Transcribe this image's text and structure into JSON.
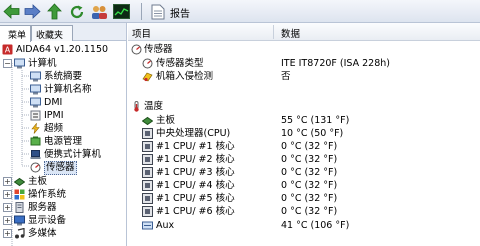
{
  "toolbar": {
    "report_label": "报告",
    "icons": [
      "back-arrow-icon",
      "forward-arrow-icon",
      "up-arrow-icon",
      "refresh-icon",
      "users-icon",
      "chart-icon",
      "report-icon"
    ]
  },
  "left_panel": {
    "tabs": [
      "菜单",
      "收藏夹"
    ],
    "tree": [
      {
        "label": "AIDA64 v1.20.1150",
        "icon": "aida64-icon"
      },
      {
        "label": "计算机",
        "icon": "computer-icon"
      },
      {
        "label": "系统摘要",
        "icon": "summary-icon"
      },
      {
        "label": "计算机名称",
        "icon": "computer-name-icon"
      },
      {
        "label": "DMI",
        "icon": "dmi-icon"
      },
      {
        "label": "IPMI",
        "icon": "ipmi-icon"
      },
      {
        "label": "超频",
        "icon": "overclock-icon"
      },
      {
        "label": "电源管理",
        "icon": "power-icon"
      },
      {
        "label": "便携式计算机",
        "icon": "laptop-icon"
      },
      {
        "label": "传感器",
        "icon": "sensor-icon",
        "selected": true
      },
      {
        "label": "主板",
        "icon": "motherboard-icon"
      },
      {
        "label": "操作系统",
        "icon": "os-icon"
      },
      {
        "label": "服务器",
        "icon": "server-icon"
      },
      {
        "label": "显示设备",
        "icon": "display-icon"
      },
      {
        "label": "多媒体",
        "icon": "multimedia-icon"
      }
    ]
  },
  "right_panel": {
    "columns": {
      "item": "项目",
      "data": "数据"
    },
    "groups": [
      {
        "title": "传感器",
        "icon": "sensor-group-icon",
        "rows": [
          {
            "item": "传感器类型",
            "value": "ITE IT8720F  (ISA 228h)",
            "icon": "sensor-icon"
          },
          {
            "item": "机箱入侵检测",
            "value": "否",
            "icon": "chassis-icon"
          }
        ]
      },
      {
        "title": "温度",
        "icon": "thermometer-icon",
        "rows": [
          {
            "item": "主板",
            "value": "55 °C  (131 °F)",
            "icon": "motherboard-icon"
          },
          {
            "item": "中央处理器(CPU)",
            "value": "10 °C  (50 °F)",
            "icon": "cpu-icon"
          },
          {
            "item": "#1 CPU/ #1 核心",
            "value": "0 °C  (32 °F)",
            "icon": "cpu-core-icon"
          },
          {
            "item": "#1 CPU/ #2 核心",
            "value": "0 °C  (32 °F)",
            "icon": "cpu-core-icon"
          },
          {
            "item": "#1 CPU/ #3 核心",
            "value": "0 °C  (32 °F)",
            "icon": "cpu-core-icon"
          },
          {
            "item": "#1 CPU/ #4 核心",
            "value": "0 °C  (32 °F)",
            "icon": "cpu-core-icon"
          },
          {
            "item": "#1 CPU/ #5 核心",
            "value": "0 °C  (32 °F)",
            "icon": "cpu-core-icon"
          },
          {
            "item": "#1 CPU/ #6 核心",
            "value": "0 °C  (32 °F)",
            "icon": "cpu-core-icon"
          },
          {
            "item": "Aux",
            "value": "41 °C  (106 °F)",
            "icon": "aux-icon"
          }
        ]
      }
    ]
  }
}
